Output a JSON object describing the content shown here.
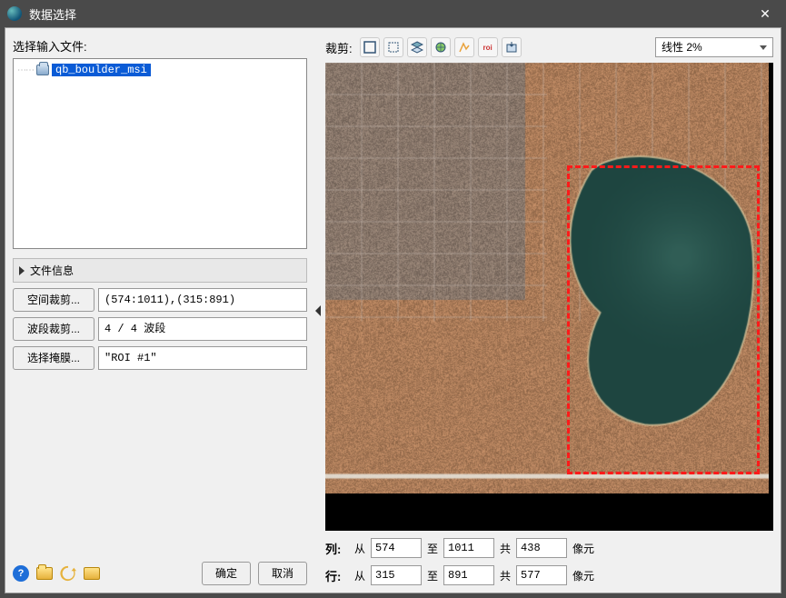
{
  "window": {
    "title": "数据选择"
  },
  "left": {
    "input_file_label": "选择输入文件:",
    "tree_item": "qb_boulder_msi",
    "file_info_header": "文件信息",
    "spatial_btn": "空间裁剪...",
    "spatial_val": "(574:1011),(315:891)",
    "band_btn": "波段裁剪...",
    "band_val": "4 / 4 波段",
    "mask_btn": "选择掩膜...",
    "mask_val": "\"ROI #1\"",
    "ok": "确定",
    "cancel": "取消"
  },
  "right": {
    "crop_label": "裁剪:",
    "stretch": "线性 2%",
    "col": {
      "label": "列:",
      "from_lbl": "从",
      "from": "574",
      "to_lbl": "至",
      "to": "1011",
      "count_lbl": "共",
      "count": "438",
      "unit": "像元"
    },
    "row": {
      "label": "行:",
      "from_lbl": "从",
      "from": "315",
      "to_lbl": "至",
      "to": "891",
      "count_lbl": "共",
      "count": "577",
      "unit": "像元"
    }
  }
}
